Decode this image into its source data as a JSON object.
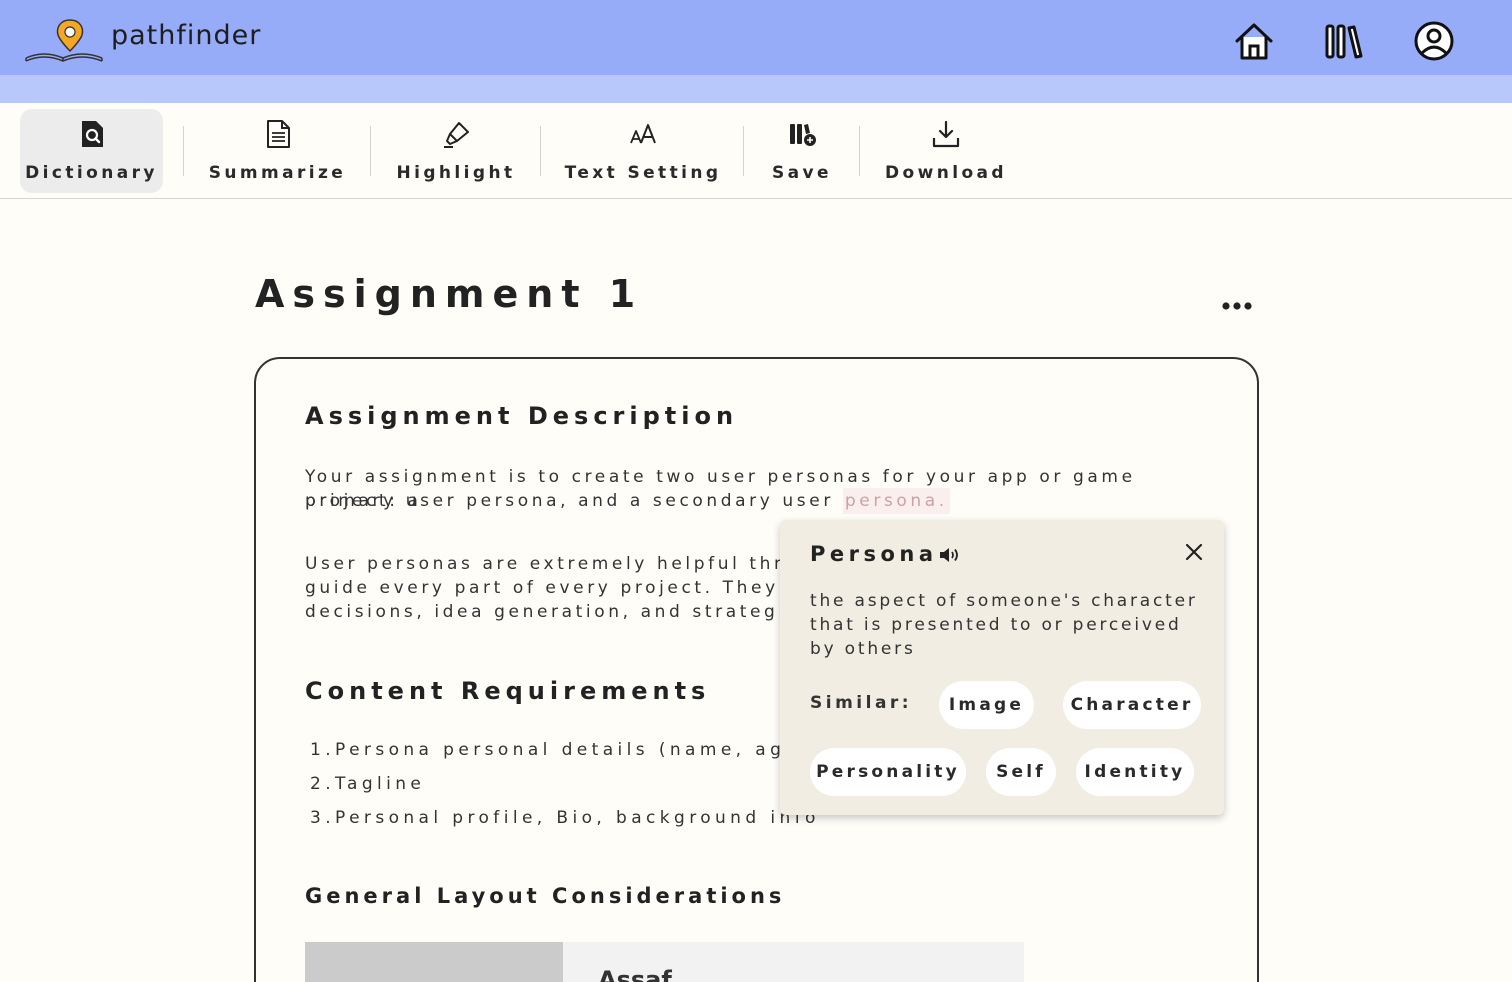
{
  "header": {
    "brand": "pathfinder",
    "icons": [
      "home-icon",
      "library-icon",
      "account-icon"
    ]
  },
  "toolbar": {
    "tools": [
      {
        "label": "Dictionary",
        "icon": "dictionary-search-icon",
        "active": true
      },
      {
        "label": "Summarize",
        "icon": "document-icon"
      },
      {
        "label": "Highlight",
        "icon": "highlighter-icon"
      },
      {
        "label": "Text Setting",
        "icon": "text-size-icon"
      },
      {
        "label": "Save",
        "icon": "save-to-library-icon"
      },
      {
        "label": "Download",
        "icon": "download-icon"
      }
    ]
  },
  "page": {
    "title": "Assignment 1"
  },
  "card": {
    "description_heading": "Assignment Description",
    "para1_line1": "Your assignment is to create two user personas for your app or game project: a",
    "para1_line2_before": "primary user persona, and a secondary user ",
    "para1_highlight": "persona.",
    "para2_line1": "User personas are extremely helpful throug",
    "para2_line2": "guide every part of every project. They prov",
    "para2_line3": "decisions, idea generation, and strategic ch",
    "requirements_heading": "Content Requirements",
    "requirements": [
      {
        "num": "1.",
        "text": "Persona personal details (name, ag"
      },
      {
        "num": "2.",
        "text": "Tagline"
      },
      {
        "num": "3.",
        "text": "Personal profile, Bio, background info"
      }
    ],
    "layout_heading": "General Layout Considerations",
    "layout_preview_name": "Assaf"
  },
  "dictionary_popup": {
    "word": "Persona",
    "definition": "the aspect of someone's character that is presented to or perceived by others",
    "similar_label": "Similar:",
    "similar": [
      "Image",
      "Character",
      "Personality",
      "Self",
      "Identity"
    ]
  },
  "colors": {
    "header_bg": "#97acf8",
    "header_strip": "#b8c8fb",
    "page_bg": "#fefdf8",
    "popup_bg": "#f1ede2",
    "logo_pin": "#f5a623"
  }
}
